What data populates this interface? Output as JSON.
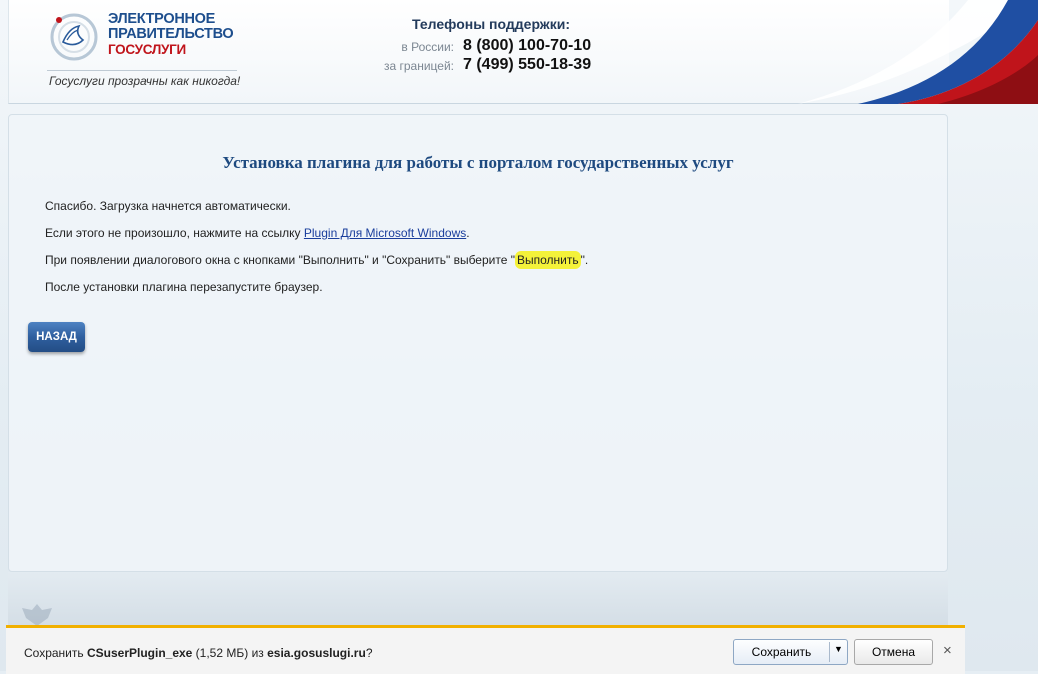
{
  "header": {
    "logo_line1": "ЭЛЕКТРОННОЕ",
    "logo_line2": "ПРАВИТЕЛЬСТВО",
    "logo_line3": "ГОСУСЛУГИ",
    "tagline": "Госуслуги прозрачны как никогда!",
    "phones_title": "Телефоны поддержки:",
    "phones": [
      {
        "label": "в России:",
        "number": "8 (800) 100-70-10"
      },
      {
        "label": "за границей:",
        "number": "7 (499) 550-18-39"
      }
    ]
  },
  "main": {
    "title": "Установка плагина для работы с порталом государственных услуг",
    "p1": "Спасибо. Загрузка начнется автоматически.",
    "p2_before": "Если этого не произошло, нажмите на ссылку ",
    "p2_link": "Plugin Для Microsoft Windows",
    "p2_after": ".",
    "p3_before": "При появлении диалогового окна с кнопками \"Выполнить\" и \"Сохранить\" выберите \"",
    "p3_highlight": "Выполнить",
    "p3_after": "\".",
    "p4": "После установки плагина перезапустите браузер.",
    "back_button": "НАЗАД"
  },
  "download_bar": {
    "prefix": "Сохранить ",
    "filename": "CSuserPlugin_exe",
    "size": " (1,52 МБ) из ",
    "site": "esia.gosuslugi.ru",
    "suffix": "?",
    "save_label": "Сохранить",
    "cancel_label": "Отмена",
    "close_glyph": "×"
  },
  "colors": {
    "accent_blue": "#1e4a80",
    "flag_red": "#c0141b",
    "download_bar_border": "#f1b000",
    "highlight": "#f4f23a"
  }
}
